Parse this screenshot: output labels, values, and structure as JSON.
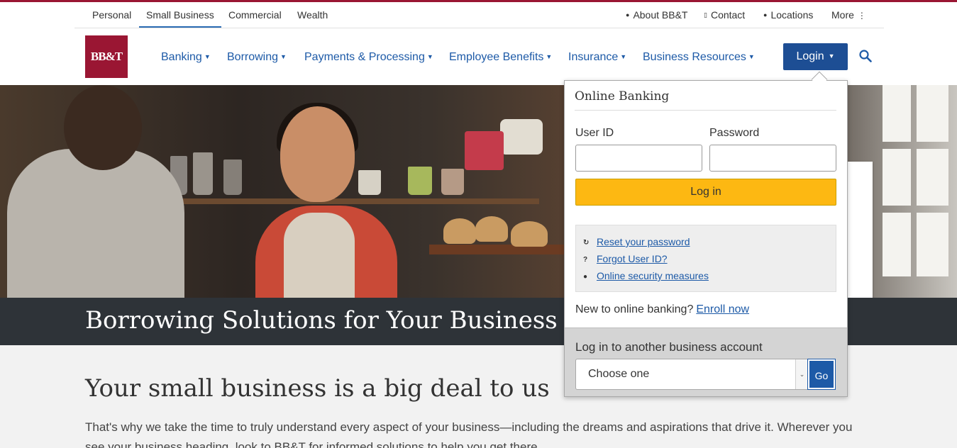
{
  "segments": [
    "Personal",
    "Small Business",
    "Commercial",
    "Wealth"
  ],
  "utility": {
    "about": "About BB&T",
    "contact": "Contact",
    "locations": "Locations",
    "more": "More"
  },
  "logo_text": "BB&T",
  "nav": {
    "items": [
      "Banking",
      "Borrowing",
      "Payments & Processing",
      "Employee Benefits",
      "Insurance",
      "Business Resources"
    ],
    "login": "Login"
  },
  "hero": {
    "banner_title": "Borrowing Solutions for Your Business"
  },
  "content": {
    "headline": "Your small business is a big deal to us",
    "body": "That's why we take the time to truly understand every aspect of your business—including the dreams and aspirations that drive it. Wherever you see your business heading, look to BB&T for informed solutions to help you get there."
  },
  "login_panel": {
    "title": "Online Banking",
    "user_id_label": "User ID",
    "password_label": "Password",
    "submit": "Log in",
    "links": [
      "Reset your password",
      "Forgot User ID?",
      "Online security measures"
    ],
    "new_text": "New to online banking?",
    "enroll": "Enroll now",
    "another_label": "Log in to another business account",
    "select_value": "Choose one",
    "go": "Go"
  },
  "colors": {
    "brand": "#9a1633",
    "link": "#1d5aa7",
    "login_button": "#1d4e94",
    "submit_button": "#fdb812",
    "banner": "#2e3338"
  }
}
